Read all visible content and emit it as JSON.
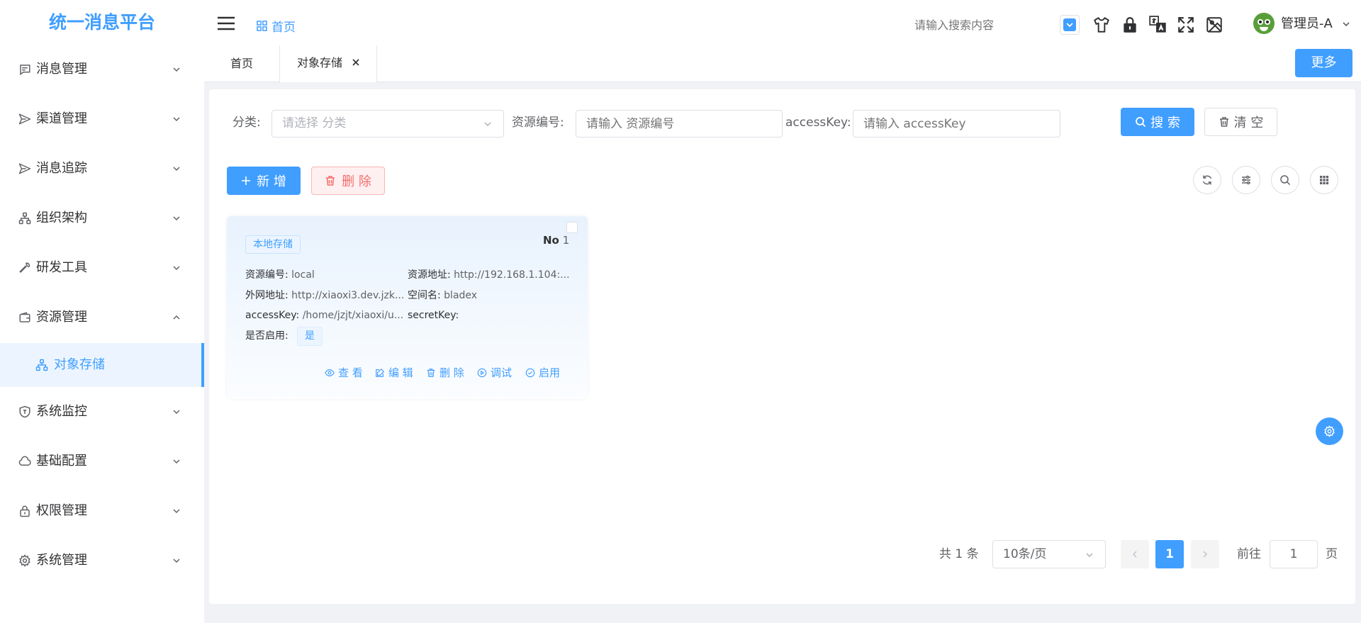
{
  "app": {
    "title": "统一消息平台"
  },
  "colors": {
    "primary": "#409eff",
    "danger": "#f56c6c",
    "text": "#303133",
    "muted": "#606266",
    "placeholder": "#b0b3b9"
  },
  "sidebar": {
    "items": [
      {
        "label": "消息管理",
        "icon": "message-icon",
        "expanded": false
      },
      {
        "label": "渠道管理",
        "icon": "send-icon",
        "expanded": false
      },
      {
        "label": "消息追踪",
        "icon": "send-icon",
        "expanded": false
      },
      {
        "label": "组织架构",
        "icon": "org-icon",
        "expanded": false
      },
      {
        "label": "研发工具",
        "icon": "wrench-icon",
        "expanded": false
      },
      {
        "label": "资源管理",
        "icon": "wallet-icon",
        "expanded": true
      },
      {
        "label": "系统监控",
        "icon": "shield-icon",
        "expanded": false
      },
      {
        "label": "基础配置",
        "icon": "cloud-icon",
        "expanded": false
      },
      {
        "label": "权限管理",
        "icon": "lock-icon",
        "expanded": false
      },
      {
        "label": "系统管理",
        "icon": "gear-icon",
        "expanded": false
      }
    ],
    "sub_item": {
      "label": "对象存储",
      "icon": "org-icon",
      "active": true
    }
  },
  "header": {
    "breadcrumb": "首页",
    "search_placeholder": "请输入搜索内容",
    "user_name": "管理员-A",
    "icons": [
      "theme-color-icon",
      "tshirt-icon",
      "lock-icon",
      "translate-icon",
      "fullscreen-icon",
      "image-icon"
    ]
  },
  "tabs": {
    "items": [
      {
        "label": "首页",
        "active": false
      },
      {
        "label": "对象存储",
        "active": true,
        "closable": true
      }
    ],
    "more_label": "更多"
  },
  "filters": {
    "category_label": "分类:",
    "category_placeholder": "请选择 分类",
    "resource_code_label": "资源编号:",
    "resource_code_placeholder": "请输入 资源编号",
    "access_key_label": "accessKey:",
    "access_key_placeholder": "请输入 accessKey",
    "search_label": "搜 索",
    "clear_label": "清 空"
  },
  "toolbar": {
    "add_label": "新 增",
    "delete_label": "删 除",
    "icons": [
      "refresh-icon",
      "columns-icon",
      "search-icon",
      "grid-icon"
    ]
  },
  "card": {
    "tag": "本地存储",
    "no_label": "No",
    "no_value": "1",
    "fields": {
      "resource_code_label": "资源编号:",
      "resource_code_value": "local",
      "resource_addr_label": "资源地址:",
      "resource_addr_value": "http://192.168.1.104:...",
      "public_addr_label": "外网地址:",
      "public_addr_value": "http://xiaoxi3.dev.jzk...",
      "space_label": "空间名:",
      "space_value": "bladex",
      "access_key_label": "accessKey:",
      "access_key_value": "/home/jzjt/xiaoxi/u...",
      "secret_key_label": "secretKey:",
      "secret_key_value": "",
      "enabled_label": "是否启用:",
      "enabled_value": "是"
    },
    "actions": {
      "view": "查 看",
      "edit": "编 辑",
      "delete": "删 除",
      "debug": "调试",
      "enable": "启用"
    }
  },
  "pagination": {
    "total": "共 1 条",
    "page_size": "10条/页",
    "current_page": "1",
    "goto_label": "前往",
    "goto_value": "1",
    "page_suffix": "页"
  }
}
